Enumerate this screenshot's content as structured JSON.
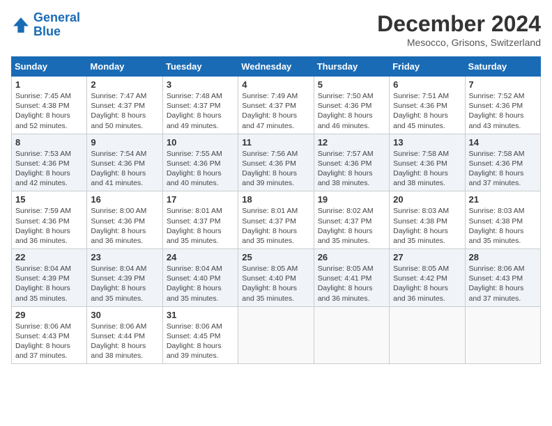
{
  "logo": {
    "line1": "General",
    "line2": "Blue"
  },
  "title": "December 2024",
  "location": "Mesocco, Grisons, Switzerland",
  "weekdays": [
    "Sunday",
    "Monday",
    "Tuesday",
    "Wednesday",
    "Thursday",
    "Friday",
    "Saturday"
  ],
  "weeks": [
    [
      {
        "day": "1",
        "info": "Sunrise: 7:45 AM\nSunset: 4:38 PM\nDaylight: 8 hours and 52 minutes."
      },
      {
        "day": "2",
        "info": "Sunrise: 7:47 AM\nSunset: 4:37 PM\nDaylight: 8 hours and 50 minutes."
      },
      {
        "day": "3",
        "info": "Sunrise: 7:48 AM\nSunset: 4:37 PM\nDaylight: 8 hours and 49 minutes."
      },
      {
        "day": "4",
        "info": "Sunrise: 7:49 AM\nSunset: 4:37 PM\nDaylight: 8 hours and 47 minutes."
      },
      {
        "day": "5",
        "info": "Sunrise: 7:50 AM\nSunset: 4:36 PM\nDaylight: 8 hours and 46 minutes."
      },
      {
        "day": "6",
        "info": "Sunrise: 7:51 AM\nSunset: 4:36 PM\nDaylight: 8 hours and 45 minutes."
      },
      {
        "day": "7",
        "info": "Sunrise: 7:52 AM\nSunset: 4:36 PM\nDaylight: 8 hours and 43 minutes."
      }
    ],
    [
      {
        "day": "8",
        "info": "Sunrise: 7:53 AM\nSunset: 4:36 PM\nDaylight: 8 hours and 42 minutes."
      },
      {
        "day": "9",
        "info": "Sunrise: 7:54 AM\nSunset: 4:36 PM\nDaylight: 8 hours and 41 minutes."
      },
      {
        "day": "10",
        "info": "Sunrise: 7:55 AM\nSunset: 4:36 PM\nDaylight: 8 hours and 40 minutes."
      },
      {
        "day": "11",
        "info": "Sunrise: 7:56 AM\nSunset: 4:36 PM\nDaylight: 8 hours and 39 minutes."
      },
      {
        "day": "12",
        "info": "Sunrise: 7:57 AM\nSunset: 4:36 PM\nDaylight: 8 hours and 38 minutes."
      },
      {
        "day": "13",
        "info": "Sunrise: 7:58 AM\nSunset: 4:36 PM\nDaylight: 8 hours and 38 minutes."
      },
      {
        "day": "14",
        "info": "Sunrise: 7:58 AM\nSunset: 4:36 PM\nDaylight: 8 hours and 37 minutes."
      }
    ],
    [
      {
        "day": "15",
        "info": "Sunrise: 7:59 AM\nSunset: 4:36 PM\nDaylight: 8 hours and 36 minutes."
      },
      {
        "day": "16",
        "info": "Sunrise: 8:00 AM\nSunset: 4:36 PM\nDaylight: 8 hours and 36 minutes."
      },
      {
        "day": "17",
        "info": "Sunrise: 8:01 AM\nSunset: 4:37 PM\nDaylight: 8 hours and 35 minutes."
      },
      {
        "day": "18",
        "info": "Sunrise: 8:01 AM\nSunset: 4:37 PM\nDaylight: 8 hours and 35 minutes."
      },
      {
        "day": "19",
        "info": "Sunrise: 8:02 AM\nSunset: 4:37 PM\nDaylight: 8 hours and 35 minutes."
      },
      {
        "day": "20",
        "info": "Sunrise: 8:03 AM\nSunset: 4:38 PM\nDaylight: 8 hours and 35 minutes."
      },
      {
        "day": "21",
        "info": "Sunrise: 8:03 AM\nSunset: 4:38 PM\nDaylight: 8 hours and 35 minutes."
      }
    ],
    [
      {
        "day": "22",
        "info": "Sunrise: 8:04 AM\nSunset: 4:39 PM\nDaylight: 8 hours and 35 minutes."
      },
      {
        "day": "23",
        "info": "Sunrise: 8:04 AM\nSunset: 4:39 PM\nDaylight: 8 hours and 35 minutes."
      },
      {
        "day": "24",
        "info": "Sunrise: 8:04 AM\nSunset: 4:40 PM\nDaylight: 8 hours and 35 minutes."
      },
      {
        "day": "25",
        "info": "Sunrise: 8:05 AM\nSunset: 4:40 PM\nDaylight: 8 hours and 35 minutes."
      },
      {
        "day": "26",
        "info": "Sunrise: 8:05 AM\nSunset: 4:41 PM\nDaylight: 8 hours and 36 minutes."
      },
      {
        "day": "27",
        "info": "Sunrise: 8:05 AM\nSunset: 4:42 PM\nDaylight: 8 hours and 36 minutes."
      },
      {
        "day": "28",
        "info": "Sunrise: 8:06 AM\nSunset: 4:43 PM\nDaylight: 8 hours and 37 minutes."
      }
    ],
    [
      {
        "day": "29",
        "info": "Sunrise: 8:06 AM\nSunset: 4:43 PM\nDaylight: 8 hours and 37 minutes."
      },
      {
        "day": "30",
        "info": "Sunrise: 8:06 AM\nSunset: 4:44 PM\nDaylight: 8 hours and 38 minutes."
      },
      {
        "day": "31",
        "info": "Sunrise: 8:06 AM\nSunset: 4:45 PM\nDaylight: 8 hours and 39 minutes."
      },
      null,
      null,
      null,
      null
    ]
  ]
}
